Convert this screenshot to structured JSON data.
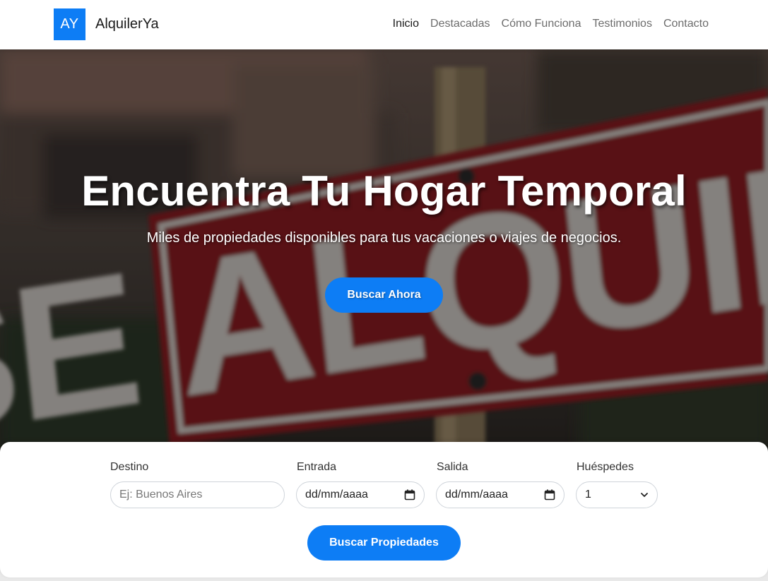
{
  "brand": {
    "logo_text": "AY",
    "name": "AlquilerYa",
    "accent_color": "#0d7df5"
  },
  "nav": {
    "items": [
      {
        "label": "Inicio",
        "active": true
      },
      {
        "label": "Destacadas",
        "active": false
      },
      {
        "label": "Cómo Funciona",
        "active": false
      },
      {
        "label": "Testimonios",
        "active": false
      },
      {
        "label": "Contacto",
        "active": false
      }
    ]
  },
  "hero": {
    "title": "Encuentra Tu Hogar Temporal",
    "subtitle": "Miles de propiedades disponibles para tus vacaciones o viajes de negocios.",
    "button_label": "Buscar Ahora",
    "background_sign_text": "SE ALQUILA"
  },
  "search": {
    "destination": {
      "label": "Destino",
      "placeholder": "Ej: Buenos Aires"
    },
    "checkin": {
      "label": "Entrada",
      "value": "dd/mm/aaaa",
      "icon": "calendar-icon"
    },
    "checkout": {
      "label": "Salida",
      "value": "dd/mm/aaaa",
      "icon": "calendar-icon"
    },
    "guests": {
      "label": "Huéspedes",
      "value": "1",
      "icon": "chevron-down-icon"
    },
    "button_label": "Buscar Propiedades"
  }
}
